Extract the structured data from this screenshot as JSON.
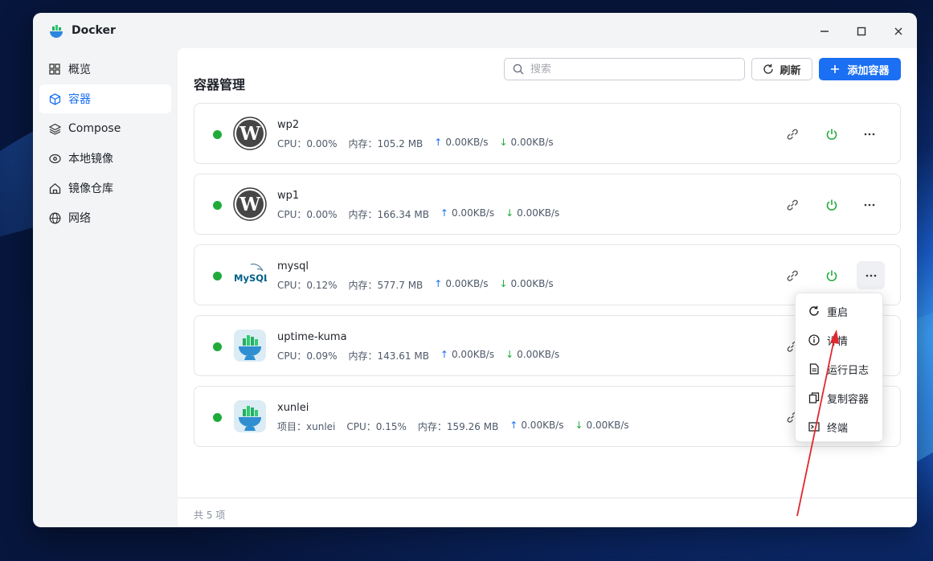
{
  "window": {
    "title": "Docker"
  },
  "sidebar": {
    "items": [
      {
        "label": "概览",
        "icon": "grid-icon"
      },
      {
        "label": "容器",
        "icon": "cube-icon",
        "active": true
      },
      {
        "label": "Compose",
        "icon": "layers-icon"
      },
      {
        "label": "本地镜像",
        "icon": "disc-icon"
      },
      {
        "label": "镜像仓库",
        "icon": "home-icon"
      },
      {
        "label": "网络",
        "icon": "globe-icon"
      }
    ]
  },
  "header": {
    "title": "容器管理",
    "search_placeholder": "搜索",
    "refresh_label": "刷新",
    "add_label": "添加容器"
  },
  "containers": [
    {
      "name": "wp2",
      "logo": "wordpress",
      "status": "running",
      "cpu": "CPU：0.00%",
      "mem": "内存：105.2 MB",
      "up": "0.00KB/s",
      "down": "0.00KB/s"
    },
    {
      "name": "wp1",
      "logo": "wordpress",
      "status": "running",
      "cpu": "CPU：0.00%",
      "mem": "内存：166.34 MB",
      "up": "0.00KB/s",
      "down": "0.00KB/s"
    },
    {
      "name": "mysql",
      "logo": "mysql",
      "status": "running",
      "cpu": "CPU：0.12%",
      "mem": "内存：577.7 MB",
      "up": "0.00KB/s",
      "down": "0.00KB/s"
    },
    {
      "name": "uptime-kuma",
      "logo": "docker-app",
      "status": "running",
      "cpu": "CPU：0.09%",
      "mem": "内存：143.61 MB",
      "up": "0.00KB/s",
      "down": "0.00KB/s"
    },
    {
      "name": "xunlei",
      "logo": "docker-app",
      "status": "running",
      "project": "项目：xunlei",
      "cpu": "CPU：0.15%",
      "mem": "内存：159.26 MB",
      "up": "0.00KB/s",
      "down": "0.00KB/s"
    }
  ],
  "logo_text": {
    "mysql": "MySQL"
  },
  "context_menu": {
    "items": [
      {
        "label": "重启",
        "icon": "restart-icon"
      },
      {
        "label": "详情",
        "icon": "info-icon"
      },
      {
        "label": "运行日志",
        "icon": "log-icon"
      },
      {
        "label": "复制容器",
        "icon": "copy-icon"
      },
      {
        "label": "终端",
        "icon": "terminal-icon"
      }
    ]
  },
  "footer": {
    "total": "共 5 项"
  },
  "colors": {
    "accent": "#1a6ff3",
    "running": "#1fab3a",
    "annotation": "#e0282e"
  }
}
